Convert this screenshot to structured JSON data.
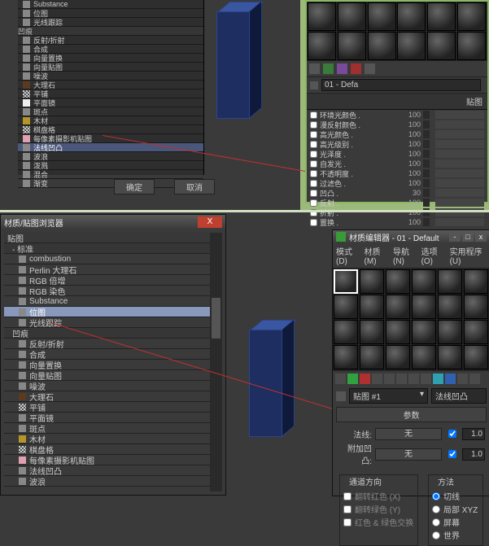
{
  "topTree": {
    "items": [
      {
        "label": "Substance",
        "icon": "grey"
      },
      {
        "label": "位图",
        "icon": "grey"
      },
      {
        "label": "光线跟踪",
        "icon": "grey"
      },
      {
        "label": "凹痕",
        "cat": true
      },
      {
        "label": "反射/折射",
        "icon": "grey"
      },
      {
        "label": "合成",
        "icon": "grey"
      },
      {
        "label": "向量置换",
        "icon": "grey"
      },
      {
        "label": "向量贴图",
        "icon": "grey"
      },
      {
        "label": "噪波",
        "icon": "grey"
      },
      {
        "label": "大理石",
        "icon": "brown"
      },
      {
        "label": "平铺",
        "icon": "check"
      },
      {
        "label": "平面镜",
        "icon": "white"
      },
      {
        "label": "斑点",
        "icon": "grey"
      },
      {
        "label": "木材",
        "icon": "yel"
      },
      {
        "label": "棋盘格",
        "icon": "check"
      },
      {
        "label": "每像素摄影机贴图",
        "icon": "pink"
      },
      {
        "label": "法线凹凸",
        "icon": "grey",
        "sel": true
      },
      {
        "label": "波浪",
        "icon": "grey"
      },
      {
        "label": "泼溅",
        "icon": "grey"
      },
      {
        "label": "混合",
        "icon": "grey"
      },
      {
        "label": "渐变",
        "icon": "grey"
      }
    ],
    "ok": "确定",
    "cancel": "取消"
  },
  "topRight": {
    "name": "01 - Defa",
    "heading": "贴图",
    "params": [
      {
        "label": "环境光颜色",
        "val": "100"
      },
      {
        "label": "漫反射颜色",
        "val": "100"
      },
      {
        "label": "高光颜色",
        "val": "100"
      },
      {
        "label": "高光级别",
        "val": "100"
      },
      {
        "label": "光泽度",
        "val": "100"
      },
      {
        "label": "自发光",
        "val": "100"
      },
      {
        "label": "不透明度",
        "val": "100"
      },
      {
        "label": "过滤色",
        "val": "100"
      },
      {
        "label": "凹凸",
        "val": "30"
      },
      {
        "label": "反射",
        "val": "100"
      },
      {
        "label": "折射",
        "val": "100"
      },
      {
        "label": "置换",
        "val": "100"
      }
    ]
  },
  "dlg": {
    "title": "材质/贴图浏览器",
    "items": [
      {
        "label": "贴图",
        "cat": 0
      },
      {
        "label": "- 标准",
        "cat": 1
      },
      {
        "label": "combustion"
      },
      {
        "label": "Perlin 大理石"
      },
      {
        "label": "RGB 倍增"
      },
      {
        "label": "RGB 染色"
      },
      {
        "label": "Substance"
      },
      {
        "label": "位图",
        "sel": true
      },
      {
        "label": "光线跟踪"
      },
      {
        "label": "凹痕",
        "cat": 1
      },
      {
        "label": "反射/折射"
      },
      {
        "label": "合成"
      },
      {
        "label": "向量置换"
      },
      {
        "label": "向量贴图"
      },
      {
        "label": "噪波"
      },
      {
        "label": "大理石",
        "icon": "brown"
      },
      {
        "label": "平铺",
        "icon": "check"
      },
      {
        "label": "平面镜"
      },
      {
        "label": "斑点"
      },
      {
        "label": "木材",
        "icon": "yel"
      },
      {
        "label": "棋盘格",
        "icon": "check"
      },
      {
        "label": "每像素摄影机贴图",
        "icon": "pink"
      },
      {
        "label": "法线凹凸"
      },
      {
        "label": "波浪"
      }
    ]
  },
  "med": {
    "title": "材质编辑器 - 01 - Default",
    "menu": [
      "模式(D)",
      "材质(M)",
      "导航(N)",
      "选项(O)",
      "实用程序(U)"
    ],
    "dropLeft": "贴图 #1",
    "dropRight": "法线凹凸",
    "rollup": "参数",
    "normal": {
      "lbl": "法线:",
      "val": "无",
      "chk": true,
      "num": "1.0"
    },
    "bump": {
      "lbl": "附加凹凸:",
      "val": "无",
      "chk": true,
      "num": "1.0"
    },
    "channelGroup": {
      "title": "通道方向",
      "items": [
        "翻转红色 (X)",
        "翻转绿色 (Y)",
        "红色 & 绿色交换"
      ]
    },
    "methodGroup": {
      "title": "方法",
      "items": [
        "切线",
        "局部 XYZ",
        "屏幕",
        "世界"
      ],
      "sel": 0
    }
  }
}
